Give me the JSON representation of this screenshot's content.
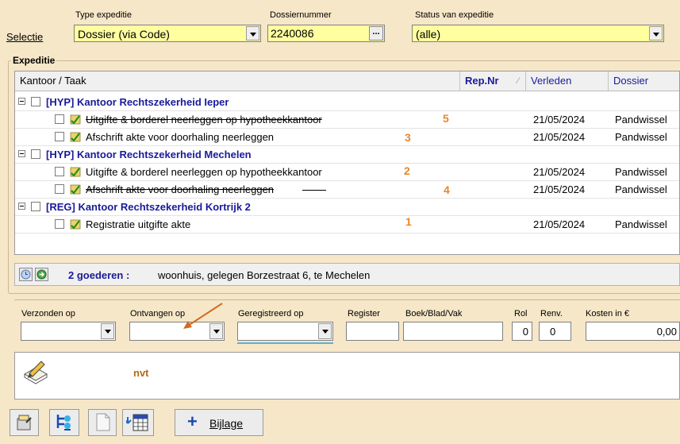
{
  "selection": {
    "selectie_label": "Selectie",
    "type_label": "Type expeditie",
    "type_value": "Dossier (via Code)",
    "dossier_label": "Dossiernummer",
    "dossier_value": "2240086",
    "dossier_browse": "...",
    "status_label": "Status van expeditie",
    "status_value": "(alle)"
  },
  "expeditie": {
    "title": "Expeditie",
    "columns": {
      "kantoor": "Kantoor / Taak",
      "repnr": "Rep.Nr",
      "verleden": "Verleden",
      "dossier": "Dossier"
    },
    "groups": [
      {
        "label": "[HYP] Kantoor Rechtszekerheid Ieper",
        "tasks": [
          {
            "label": "Uitgifte & borderel neerleggen op hypotheekkantoor",
            "struck": true,
            "annotation": "5",
            "verleden": "21/05/2024",
            "dossier": "Pandwissel"
          },
          {
            "label": "Afschrift akte voor doorhaling neerleggen",
            "struck": false,
            "annotation": "3",
            "verleden": "21/05/2024",
            "dossier": "Pandwissel"
          }
        ]
      },
      {
        "label": "[HYP] Kantoor Rechtszekerheid Mechelen",
        "tasks": [
          {
            "label": "Uitgifte & borderel neerleggen op hypotheekkantoor",
            "struck": false,
            "annotation": "2",
            "verleden": "21/05/2024",
            "dossier": "Pandwissel"
          },
          {
            "label": "Afschrift akte voor doorhaling neerleggen",
            "struck": true,
            "annotation": "4",
            "verleden": "21/05/2024",
            "dossier": "Pandwissel"
          }
        ]
      },
      {
        "label": "[REG] Kantoor Rechtszekerheid Kortrijk 2",
        "tasks": [
          {
            "label": "Registratie uitgifte akte",
            "struck": false,
            "annotation": "1",
            "verleden": "21/05/2024",
            "dossier": "Pandwissel"
          }
        ]
      }
    ]
  },
  "goods": {
    "count_label": "2 goederen :",
    "description": "woonhuis, gelegen Borzestraat 6, te Mechelen"
  },
  "detail": {
    "verzonden_label": "Verzonden op",
    "ontvangen_label": "Ontvangen op",
    "geregistreerd_label": "Geregistreerd op",
    "register_label": "Register",
    "boek_label": "Boek/Blad/Vak",
    "rol_label": "Rol",
    "rol_value": "0",
    "renv_label": "Renv.",
    "renv_value": "0",
    "kosten_label": "Kosten in €",
    "kosten_value": "0,00",
    "note": "nvt"
  },
  "toolbar": {
    "bijlage_label": "Bijlage"
  },
  "colors": {
    "accent_orange": "#e8862a",
    "group_blue": "#1a1a9a",
    "field_yellow": "#ffffa0"
  }
}
